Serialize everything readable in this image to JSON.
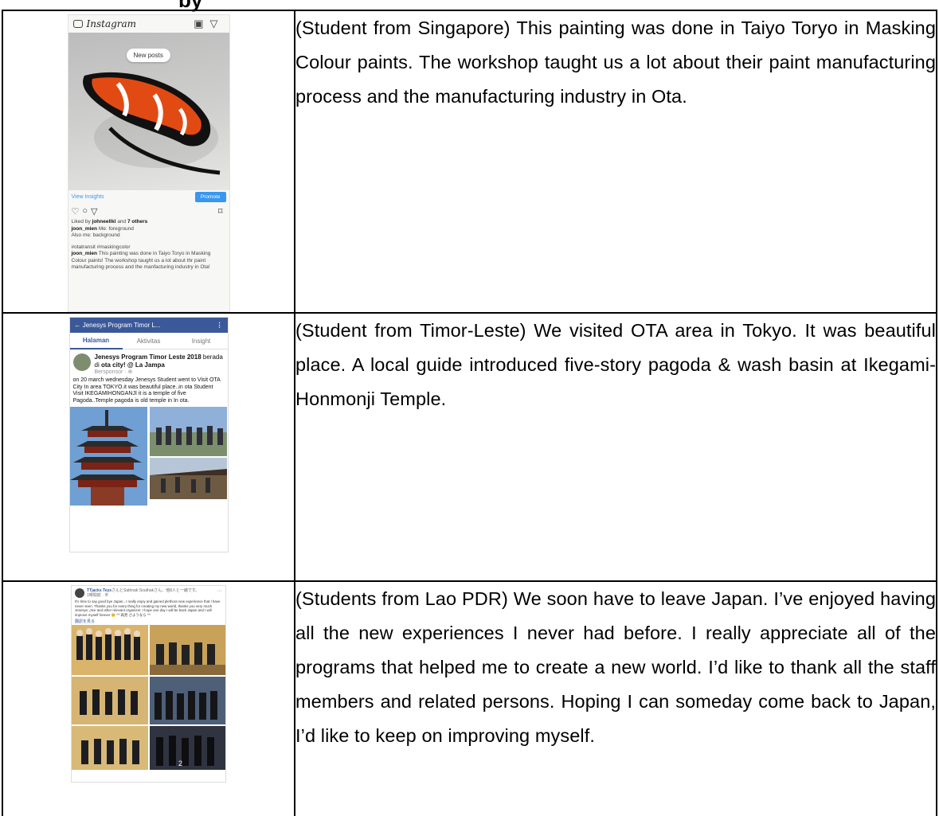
{
  "heading_fragment": "by",
  "rows": [
    {
      "caption": "(Student from Singapore) This painting was done in Taiyo Toryo in Masking Colour paints. The workshop taught us a lot about their paint manufacturing process and the manufacturing industry in Ota.",
      "screenshot": {
        "app": "Instagram",
        "pill": "New posts",
        "view_insights": "View Insights",
        "promote": "Promote",
        "liked_by_prefix": "Liked by ",
        "liked_by_user": "johneellkl",
        "liked_by_suffix": " and ",
        "liked_by_others": "7 others",
        "user": "joon_mien",
        "comment1": " Me: foreground",
        "comment2": "Also me: background",
        "hashtags": "#otatransit #maskingcolor",
        "caption_text": " This painting was done in Taiyo Toryo in Masking Colour paints! The workshop taught us a lot about thr paint manufacturing process and the manfacturing industry in Ota!"
      }
    },
    {
      "caption": "(Student from Timor-Leste) We visited OTA area in Tokyo. It was beautiful place. A local guide introduced five-story pagoda & wash basin at Ikegami-Honmonji Temple.",
      "screenshot": {
        "header": "←  Jenesys Program Timor L...",
        "more": "⋮",
        "tabs": [
          "Halaman",
          "Aktivitas",
          "Insight"
        ],
        "page_name": "Jenesys Program Timor Leste 2018",
        "at_text": " berada di ",
        "place": "ota city! @ La Jampa",
        "sponsored": "Bersponsor · ⊕",
        "body": "on 20 march wednesday Jenesys Student went to Visit OTA City In area TOKYO.it was beautiful place..in ota Student Visit IKEGAMIHONGANJI it is a temple of five Pagoda..Temple pagoda is old temple in In ota."
      }
    },
    {
      "caption": "(Students from Lao PDR) We soon have to leave Japan. I’ve enjoyed having all the new experiences I never had before. I really appreciate all of the programs that helped me to create a new world. I’d like to thank all the staff members and related persons. Hoping I can someday come back to Japan, I’d like to keep on improving myself.",
      "screenshot": {
        "name": "TTjacks Teys",
        "name_suffix": "さんとSathnak Southakさん、他8人と一緒です。",
        "time": "1時間前 · ⊕",
        "more": "···",
        "body": "It's time to say good bye Japan.. I really enjoy and gained plethora new experience that I have never seen. Thanks you for every thing for creating my new world, thanks you very much Jenesys ,Jice and other relevant organizer. I hope one day I will be back Japan and I will improve myself forever 😊 ^^ 再見 さようなら ^^",
        "see_translation": "翻訳を見る",
        "page_number": "2"
      }
    }
  ]
}
